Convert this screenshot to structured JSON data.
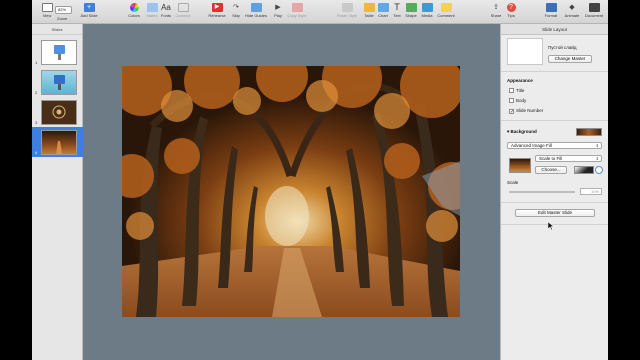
{
  "toolbar": {
    "view": "View",
    "zoom_value": "82%",
    "zoom": "Zoom",
    "add_slide": "Add Slide",
    "colors": "Colors",
    "mates": "Mates",
    "fonts": "Fonts",
    "connect": "Connect",
    "rehearse": "Rehearse",
    "skip": "Skip",
    "hide_guides": "Hide Guides",
    "play": "Play",
    "copy_style": "Copy Style",
    "paste_style": "Paste Style",
    "table": "Table",
    "chart": "Chart",
    "text": "Text",
    "shape": "Shape",
    "media": "Media",
    "comment": "Comment",
    "share": "Share",
    "tips": "Tips",
    "format": "Format",
    "animate": "Animate",
    "document": "Document"
  },
  "navigator": {
    "header": "Slides",
    "slides": [
      {
        "number": "1"
      },
      {
        "number": "2"
      },
      {
        "number": "3"
      },
      {
        "number": "4"
      }
    ]
  },
  "inspector": {
    "title": "Slide Layout",
    "master_name": "Пустой слайд",
    "change_master": "Change Master",
    "appearance": "Appearance",
    "title_cb": "Title",
    "body_cb": "Body",
    "slide_number_cb": "Slide Number",
    "background": "Background",
    "fill_type": "Advanced Image Fill",
    "scale_mode": "Scale to Fill",
    "choose": "Choose...",
    "scale": "Scale",
    "scale_value": "10%",
    "edit_master": "Edit Master Slide"
  },
  "colors": {
    "selection": "#3d80df",
    "canvas": "#6d7b87"
  }
}
